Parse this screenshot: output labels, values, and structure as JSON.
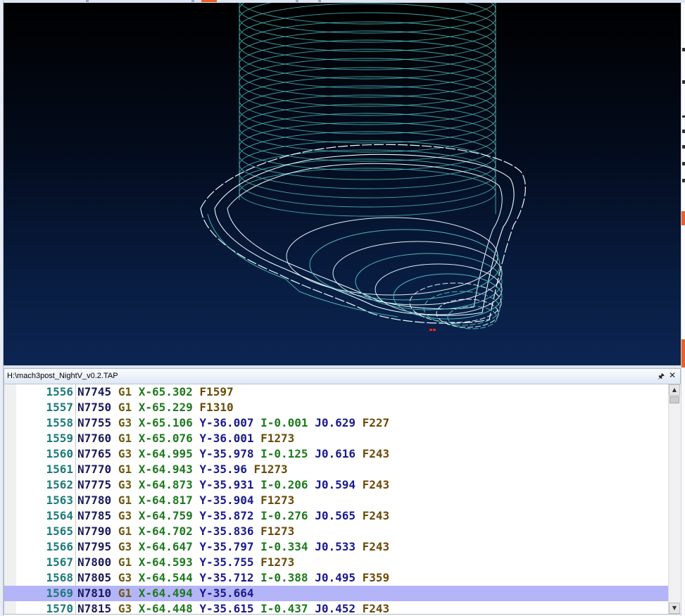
{
  "editor_panel": {
    "title": "H:\\mach3post_NightV_v0.2.TAP",
    "pin_icon": "pin-icon",
    "close_icon": "close-icon"
  },
  "colors": {
    "toolpath": "#4fc1c1",
    "toolpath_highlight": "#e8fdfd",
    "active_line_bg": "#b4b4f8",
    "viewport_top": "#000000",
    "viewport_bottom": "#0c2552"
  },
  "gcode_lines": [
    {
      "num": "1556",
      "tokens": [
        {
          "t": "N7745",
          "k": "n"
        },
        {
          "t": "G1",
          "k": "g"
        },
        {
          "t": "X-65.302",
          "k": "x"
        },
        {
          "t": "F1597",
          "k": "f"
        }
      ]
    },
    {
      "num": "1557",
      "tokens": [
        {
          "t": "N7750",
          "k": "n"
        },
        {
          "t": "G1",
          "k": "g"
        },
        {
          "t": "X-65.229",
          "k": "x"
        },
        {
          "t": "F1310",
          "k": "f"
        }
      ]
    },
    {
      "num": "1558",
      "tokens": [
        {
          "t": "N7755",
          "k": "n"
        },
        {
          "t": "G3",
          "k": "g"
        },
        {
          "t": "X-65.106",
          "k": "x"
        },
        {
          "t": "Y-36.007",
          "k": "y"
        },
        {
          "t": "I-0.001",
          "k": "i"
        },
        {
          "t": "J0.629",
          "k": "j"
        },
        {
          "t": "F227",
          "k": "f"
        }
      ]
    },
    {
      "num": "1559",
      "tokens": [
        {
          "t": "N7760",
          "k": "n"
        },
        {
          "t": "G1",
          "k": "g"
        },
        {
          "t": "X-65.076",
          "k": "x"
        },
        {
          "t": "Y-36.001",
          "k": "y"
        },
        {
          "t": "F1273",
          "k": "f"
        }
      ]
    },
    {
      "num": "1560",
      "tokens": [
        {
          "t": "N7765",
          "k": "n"
        },
        {
          "t": "G3",
          "k": "g"
        },
        {
          "t": "X-64.995",
          "k": "x"
        },
        {
          "t": "Y-35.978",
          "k": "y"
        },
        {
          "t": "I-0.125",
          "k": "i"
        },
        {
          "t": "J0.616",
          "k": "j"
        },
        {
          "t": "F243",
          "k": "f"
        }
      ]
    },
    {
      "num": "1561",
      "tokens": [
        {
          "t": "N7770",
          "k": "n"
        },
        {
          "t": "G1",
          "k": "g"
        },
        {
          "t": "X-64.943",
          "k": "x"
        },
        {
          "t": "Y-35.96",
          "k": "y"
        },
        {
          "t": "F1273",
          "k": "f"
        }
      ]
    },
    {
      "num": "1562",
      "tokens": [
        {
          "t": "N7775",
          "k": "n"
        },
        {
          "t": "G3",
          "k": "g"
        },
        {
          "t": "X-64.873",
          "k": "x"
        },
        {
          "t": "Y-35.931",
          "k": "y"
        },
        {
          "t": "I-0.206",
          "k": "i"
        },
        {
          "t": "J0.594",
          "k": "j"
        },
        {
          "t": "F243",
          "k": "f"
        }
      ]
    },
    {
      "num": "1563",
      "tokens": [
        {
          "t": "N7780",
          "k": "n"
        },
        {
          "t": "G1",
          "k": "g"
        },
        {
          "t": "X-64.817",
          "k": "x"
        },
        {
          "t": "Y-35.904",
          "k": "y"
        },
        {
          "t": "F1273",
          "k": "f"
        }
      ]
    },
    {
      "num": "1564",
      "tokens": [
        {
          "t": "N7785",
          "k": "n"
        },
        {
          "t": "G3",
          "k": "g"
        },
        {
          "t": "X-64.759",
          "k": "x"
        },
        {
          "t": "Y-35.872",
          "k": "y"
        },
        {
          "t": "I-0.276",
          "k": "i"
        },
        {
          "t": "J0.565",
          "k": "j"
        },
        {
          "t": "F243",
          "k": "f"
        }
      ]
    },
    {
      "num": "1565",
      "tokens": [
        {
          "t": "N7790",
          "k": "n"
        },
        {
          "t": "G1",
          "k": "g"
        },
        {
          "t": "X-64.702",
          "k": "x"
        },
        {
          "t": "Y-35.836",
          "k": "y"
        },
        {
          "t": "F1273",
          "k": "f"
        }
      ]
    },
    {
      "num": "1566",
      "tokens": [
        {
          "t": "N7795",
          "k": "n"
        },
        {
          "t": "G3",
          "k": "g"
        },
        {
          "t": "X-64.647",
          "k": "x"
        },
        {
          "t": "Y-35.797",
          "k": "y"
        },
        {
          "t": "I-0.334",
          "k": "i"
        },
        {
          "t": "J0.533",
          "k": "j"
        },
        {
          "t": "F243",
          "k": "f"
        }
      ]
    },
    {
      "num": "1567",
      "tokens": [
        {
          "t": "N7800",
          "k": "n"
        },
        {
          "t": "G1",
          "k": "g"
        },
        {
          "t": "X-64.593",
          "k": "x"
        },
        {
          "t": "Y-35.755",
          "k": "y"
        },
        {
          "t": "F1273",
          "k": "f"
        }
      ]
    },
    {
      "num": "1568",
      "tokens": [
        {
          "t": "N7805",
          "k": "n"
        },
        {
          "t": "G3",
          "k": "g"
        },
        {
          "t": "X-64.544",
          "k": "x"
        },
        {
          "t": "Y-35.712",
          "k": "y"
        },
        {
          "t": "I-0.388",
          "k": "i"
        },
        {
          "t": "J0.495",
          "k": "j"
        },
        {
          "t": "F359",
          "k": "f"
        }
      ]
    },
    {
      "num": "1569",
      "active": true,
      "tokens": [
        {
          "t": "N7810",
          "k": "n"
        },
        {
          "t": "G1",
          "k": "g"
        },
        {
          "t": "X-64.494",
          "k": "x"
        },
        {
          "t": "Y-35.664",
          "k": "y"
        }
      ]
    },
    {
      "num": "1570",
      "tokens": [
        {
          "t": "N7815",
          "k": "n"
        },
        {
          "t": "G3",
          "k": "g"
        },
        {
          "t": "X-64.448",
          "k": "x"
        },
        {
          "t": "Y-35.615",
          "k": "y"
        },
        {
          "t": "I-0.437",
          "k": "i"
        },
        {
          "t": "J0.452",
          "k": "j"
        },
        {
          "t": "F243",
          "k": "f"
        }
      ]
    }
  ]
}
